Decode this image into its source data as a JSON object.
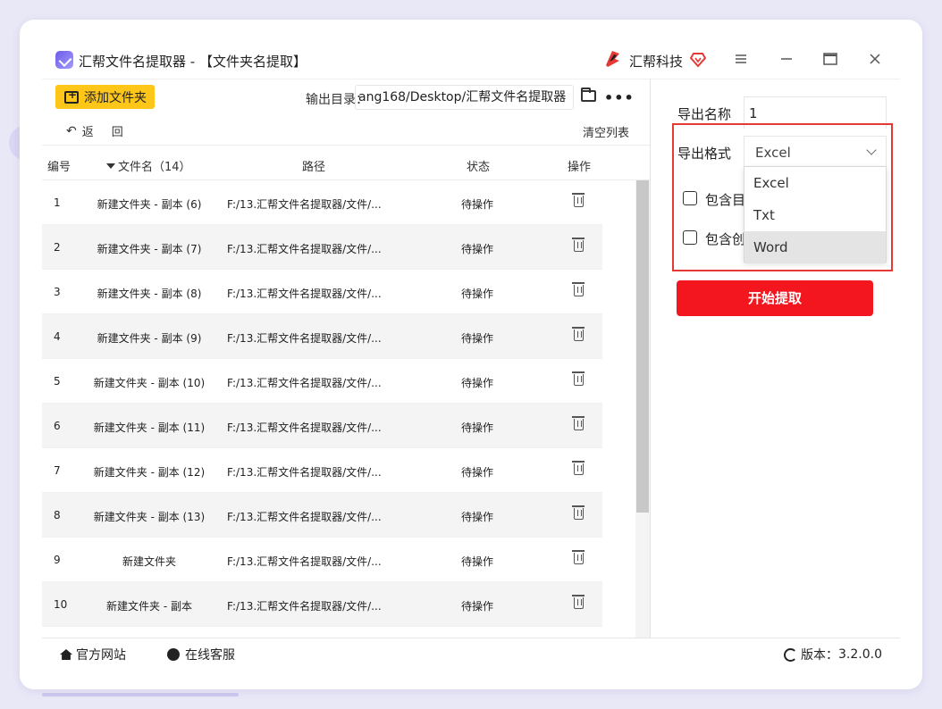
{
  "app": {
    "title": "汇帮文件名提取器 - 【文件夹名提取】",
    "brand_name": "汇帮科技"
  },
  "toolbar": {
    "add_folder_label": "添加文件夹",
    "output_dir_label": "输出目录：",
    "output_dir_value": "ang168/Desktop/汇帮文件名提取器",
    "more_label": "•••",
    "back_label": "返回",
    "clear_list_label": "清空列表"
  },
  "table": {
    "headers": {
      "num": "编号",
      "name": "文件名（14）",
      "path": "路径",
      "status": "状态",
      "op": "操作"
    },
    "rows": [
      {
        "num": "1",
        "name": "新建文件夹 - 副本 (6)",
        "path": "F:/13.汇帮文件名提取器/文件/...",
        "status": "待操作"
      },
      {
        "num": "2",
        "name": "新建文件夹 - 副本 (7)",
        "path": "F:/13.汇帮文件名提取器/文件/...",
        "status": "待操作"
      },
      {
        "num": "3",
        "name": "新建文件夹 - 副本 (8)",
        "path": "F:/13.汇帮文件名提取器/文件/...",
        "status": "待操作"
      },
      {
        "num": "4",
        "name": "新建文件夹 - 副本 (9)",
        "path": "F:/13.汇帮文件名提取器/文件/...",
        "status": "待操作"
      },
      {
        "num": "5",
        "name": "新建文件夹 - 副本 (10)",
        "path": "F:/13.汇帮文件名提取器/文件/...",
        "status": "待操作"
      },
      {
        "num": "6",
        "name": "新建文件夹 - 副本 (11)",
        "path": "F:/13.汇帮文件名提取器/文件/...",
        "status": "待操作"
      },
      {
        "num": "7",
        "name": "新建文件夹 - 副本 (12)",
        "path": "F:/13.汇帮文件名提取器/文件/...",
        "status": "待操作"
      },
      {
        "num": "8",
        "name": "新建文件夹 - 副本 (13)",
        "path": "F:/13.汇帮文件名提取器/文件/...",
        "status": "待操作"
      },
      {
        "num": "9",
        "name": "新建文件夹",
        "path": "F:/13.汇帮文件名提取器/文件/...",
        "status": "待操作"
      },
      {
        "num": "10",
        "name": "新建文件夹 - 副本",
        "path": "F:/13.汇帮文件名提取器/文件/...",
        "status": "待操作"
      }
    ]
  },
  "settings": {
    "export_name_label": "导出名称",
    "export_name_value": "1",
    "export_format_label": "导出格式",
    "export_format_value": "Excel",
    "format_options": [
      "Excel",
      "Txt",
      "Word"
    ],
    "checkbox1_label": "包含目",
    "checkbox2_label": "包含创",
    "start_button_label": "开始提取"
  },
  "footer": {
    "website_label": "官方网站",
    "service_label": "在线客服",
    "version_label": "版本：",
    "version_value": "3.2.0.0"
  },
  "colors": {
    "accent_yellow": "#ffc61a",
    "start_red": "#f4161f",
    "highlight_red": "#e53935"
  }
}
